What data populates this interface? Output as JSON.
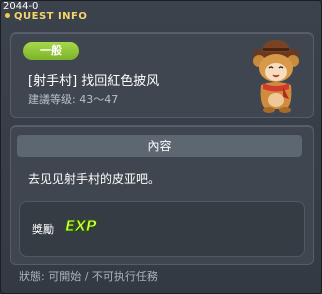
{
  "version": "2044-0",
  "window": {
    "title": "QUEST INFO"
  },
  "quest": {
    "category": "一般",
    "name": "[射手村] 找回紅色披风",
    "level": "建議等级: 43～47",
    "npc_icon": "bear-costume-npc-icon"
  },
  "content": {
    "header": "內容",
    "text": "去见见射手村的皮亚吧。"
  },
  "reward": {
    "label": "獎勵",
    "icon_text": "EXP"
  },
  "status": "狀態: 可開始 / 不可执行任務",
  "colors": {
    "title": "#f6d66b",
    "badge": "#8fc53a",
    "exp": "#d8ff42"
  }
}
